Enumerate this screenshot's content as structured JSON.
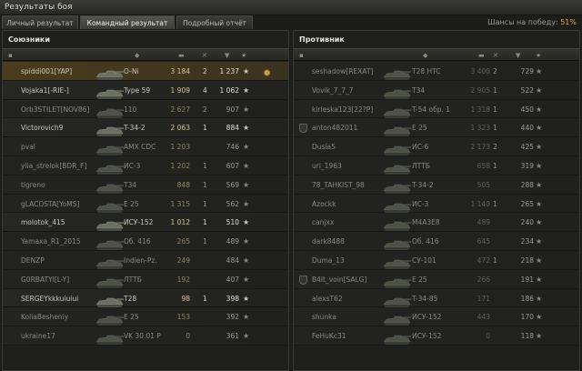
{
  "window": {
    "title": "Результаты боя"
  },
  "tabs": [
    {
      "label": "Личный результат",
      "active": false
    },
    {
      "label": "Командный результат",
      "active": true
    },
    {
      "label": "Подробный отчёт",
      "active": false
    }
  ],
  "win_chance": {
    "label": "Шансы на победу:",
    "value": "51%"
  },
  "allies": {
    "title": "Союзники",
    "rows": [
      {
        "name": "spiddi001[YAP]",
        "vehicle": "O-Ni",
        "damage": "3 184",
        "kills": "2",
        "xp": "1 237",
        "me": true,
        "alive": true,
        "badge": true
      },
      {
        "name": "Vojaka1[-RIE-]",
        "vehicle": "Type 59",
        "damage": "1 909",
        "kills": "4",
        "xp": "1 062",
        "alive": true
      },
      {
        "name": "Orb3STILET[NOV86]",
        "vehicle": "110",
        "damage": "2 627",
        "kills": "2",
        "xp": "907",
        "alive": false
      },
      {
        "name": "Victorovich9",
        "vehicle": "T-34-2",
        "damage": "2 063",
        "kills": "1",
        "xp": "884",
        "alive": true
      },
      {
        "name": "pval",
        "vehicle": "AMX CDC",
        "damage": "1 203",
        "kills": "",
        "xp": "746",
        "alive": false
      },
      {
        "name": "ylia_strelok[BDR_F]",
        "vehicle": "ИС-3",
        "damage": "1 202",
        "kills": "1",
        "xp": "607",
        "alive": false
      },
      {
        "name": "tigreno",
        "vehicle": "T34",
        "damage": "848",
        "kills": "1",
        "xp": "569",
        "alive": false
      },
      {
        "name": "gLACOSTA[YoMS]",
        "vehicle": "E 25",
        "damage": "1 315",
        "kills": "1",
        "xp": "562",
        "alive": false
      },
      {
        "name": "molotok_415",
        "vehicle": "ИСУ-152",
        "damage": "1 012",
        "kills": "1",
        "xp": "510",
        "alive": true
      },
      {
        "name": "Yamaxa_R1_2015",
        "vehicle": "Об. 416",
        "damage": "265",
        "kills": "1",
        "xp": "489",
        "alive": false
      },
      {
        "name": "DENZP",
        "vehicle": "Indien-Pz.",
        "damage": "249",
        "kills": "",
        "xp": "484",
        "alive": false
      },
      {
        "name": "G0RBATYI[L-Y]",
        "vehicle": "ЛТТБ",
        "damage": "192",
        "kills": "",
        "xp": "407",
        "alive": false
      },
      {
        "name": "SERGEYkkkuiuiui",
        "vehicle": "T28",
        "damage": "98",
        "kills": "1",
        "xp": "398",
        "alive": true
      },
      {
        "name": "KoliaBesheniy",
        "vehicle": "E 25",
        "damage": "153",
        "kills": "",
        "xp": "392",
        "alive": false
      },
      {
        "name": "ukraine17",
        "vehicle": "VK 30.01 P",
        "damage": "0",
        "kills": "",
        "xp": "361",
        "alive": false
      }
    ]
  },
  "enemies": {
    "title": "Противник",
    "rows": [
      {
        "name": "seshadow[REXAT]",
        "vehicle": "T28 HTC",
        "damage": "3 400",
        "kills": "2",
        "xp": "729",
        "alive": false
      },
      {
        "name": "Vovik_7_7_7",
        "vehicle": "T34",
        "damage": "2 905",
        "kills": "1",
        "xp": "522",
        "alive": false
      },
      {
        "name": "kirieska123[22?P]",
        "vehicle": "T-54 обр. 1",
        "damage": "1 318",
        "kills": "1",
        "xp": "450",
        "alive": false
      },
      {
        "name": "anton482011",
        "vehicle": "E 25",
        "damage": "1 323",
        "kills": "1",
        "xp": "440",
        "alive": false,
        "clan_icon": true
      },
      {
        "name": "Dusia5",
        "vehicle": "ИС-6",
        "damage": "2 173",
        "kills": "2",
        "xp": "425",
        "alive": false
      },
      {
        "name": "uri_1963",
        "vehicle": "ЛТТБ",
        "damage": "658",
        "kills": "1",
        "xp": "319",
        "alive": false
      },
      {
        "name": "78_TAHKIST_98",
        "vehicle": "T-34-2",
        "damage": "505",
        "kills": "",
        "xp": "288",
        "alive": false
      },
      {
        "name": "Azockk",
        "vehicle": "ИС-3",
        "damage": "1 140",
        "kills": "1",
        "xp": "265",
        "alive": false
      },
      {
        "name": "canjxx",
        "vehicle": "M4A3E8",
        "damage": "489",
        "kills": "",
        "xp": "240",
        "alive": false
      },
      {
        "name": "dark8488",
        "vehicle": "Об. 416",
        "damage": "645",
        "kills": "",
        "xp": "234",
        "alive": false
      },
      {
        "name": "Duma_13",
        "vehicle": "СУ-101",
        "damage": "472",
        "kills": "1",
        "xp": "218",
        "alive": false
      },
      {
        "name": "B4it_voin[SALG]",
        "vehicle": "E 25",
        "damage": "266",
        "kills": "",
        "xp": "191",
        "alive": false,
        "clan_icon": true
      },
      {
        "name": "alexsT62",
        "vehicle": "T-34-85",
        "damage": "171",
        "kills": "",
        "xp": "186",
        "alive": false
      },
      {
        "name": "shunka",
        "vehicle": "ИСУ-152",
        "damage": "443",
        "kills": "",
        "xp": "170",
        "alive": false
      },
      {
        "name": "FeHuKc31",
        "vehicle": "ИСУ-152",
        "damage": "0",
        "kills": "",
        "xp": "118",
        "alive": false
      }
    ]
  },
  "icons": {
    "star": "★",
    "tank_silhouette": "tank-icon",
    "achievement_badge": "badge-icon"
  },
  "colors": {
    "accent": "#e0b040",
    "me_row": "#4a3c1c"
  }
}
